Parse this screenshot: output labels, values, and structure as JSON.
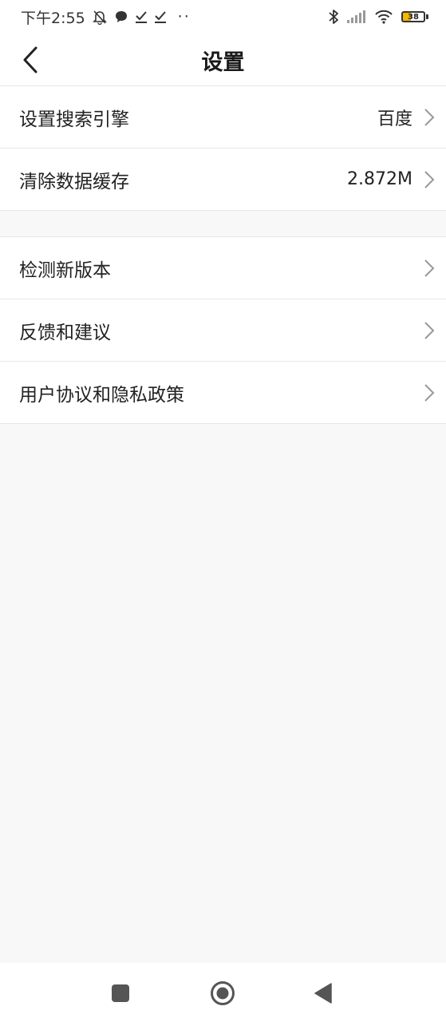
{
  "status_bar": {
    "time": "下午2:55",
    "more_dots": "··",
    "battery_level": "38",
    "battery_percent": 38,
    "battery_color": "#f2b705"
  },
  "header": {
    "title": "设置",
    "back_icon": "chevron-left-icon"
  },
  "settings_group_1": [
    {
      "label": "设置搜索引擎",
      "value": "百度"
    },
    {
      "label": "清除数据缓存",
      "value": "2.872M"
    }
  ],
  "settings_group_2": [
    {
      "label": "检测新版本"
    },
    {
      "label": "反馈和建议"
    },
    {
      "label": "用户协议和隐私政策"
    }
  ],
  "nav_bar": {
    "recent_icon": "square-icon",
    "home_icon": "circle-icon",
    "back_icon": "triangle-back-icon"
  },
  "colors": {
    "background": "#f8f8f8",
    "surface": "#ffffff",
    "divider": "#e6e6e6",
    "chevron": "#999999",
    "nav_icon": "#555555"
  }
}
